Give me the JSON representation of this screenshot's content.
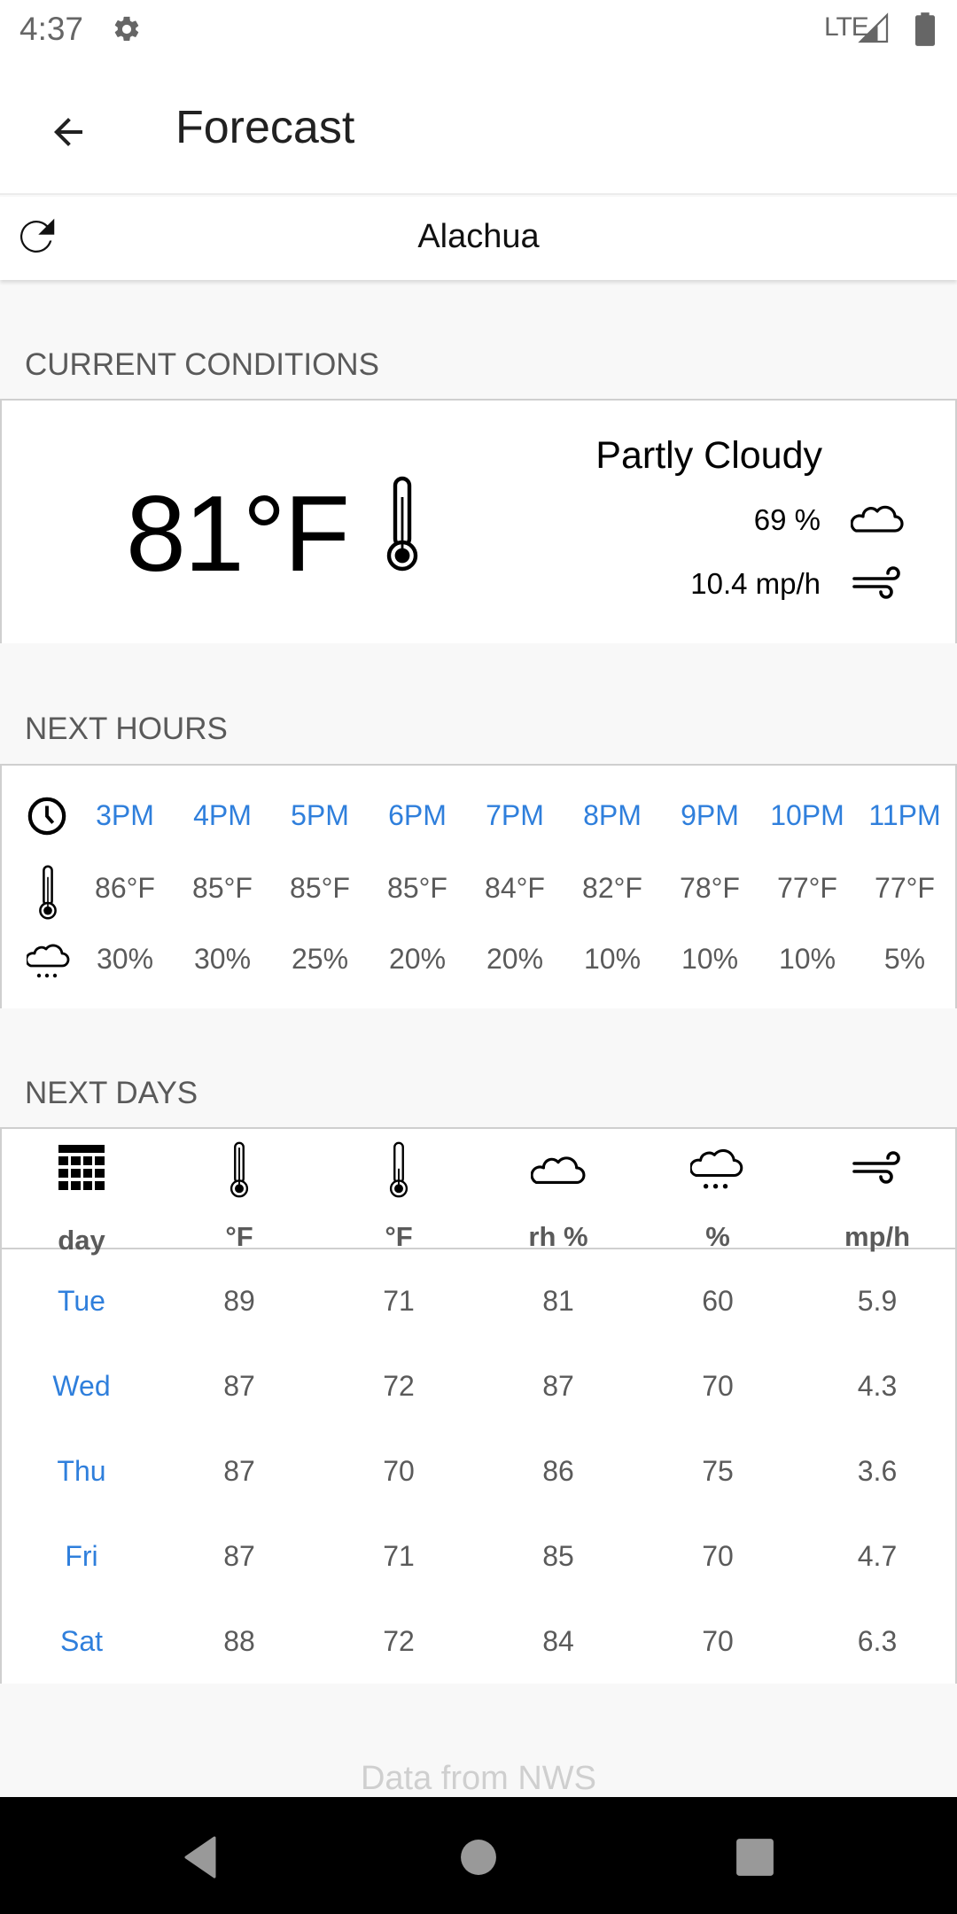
{
  "status_bar": {
    "time": "4:37",
    "network": "LTE",
    "icons": [
      "gear-icon",
      "signal-icon",
      "battery-icon"
    ]
  },
  "app_bar": {
    "title": "Forecast",
    "back_icon": "arrow-left-icon"
  },
  "location_bar": {
    "location": "Alachua",
    "refresh_icon": "refresh-icon"
  },
  "current_conditions": {
    "header": "CURRENT CONDITIONS",
    "temperature": "81°F",
    "condition": "Partly Cloudy",
    "humidity": "69 %",
    "wind": "10.4 mp/h"
  },
  "next_hours": {
    "header": "NEXT HOURS",
    "times": [
      "3PM",
      "4PM",
      "5PM",
      "6PM",
      "7PM",
      "8PM",
      "9PM",
      "10PM",
      "11PM"
    ],
    "temperatures": [
      "86°F",
      "85°F",
      "85°F",
      "85°F",
      "84°F",
      "82°F",
      "78°F",
      "77°F",
      "77°F"
    ],
    "precipitation": [
      "30%",
      "30%",
      "25%",
      "20%",
      "20%",
      "10%",
      "10%",
      "10%",
      "5%"
    ]
  },
  "next_days": {
    "header": "NEXT DAYS",
    "columns": [
      {
        "icon": "calendar-icon",
        "label": "day"
      },
      {
        "icon": "thermometer-high-icon",
        "label": "°F"
      },
      {
        "icon": "thermometer-low-icon",
        "label": "°F"
      },
      {
        "icon": "cloud-icon",
        "label": "rh %"
      },
      {
        "icon": "rain-cloud-icon",
        "label": "%"
      },
      {
        "icon": "wind-icon",
        "label": "mp/h"
      }
    ],
    "rows": [
      [
        "Tue",
        "89",
        "71",
        "81",
        "60",
        "5.9"
      ],
      [
        "Wed",
        "87",
        "72",
        "87",
        "70",
        "4.3"
      ],
      [
        "Thu",
        "87",
        "70",
        "86",
        "75",
        "3.6"
      ],
      [
        "Fri",
        "87",
        "71",
        "85",
        "70",
        "4.7"
      ],
      [
        "Sat",
        "88",
        "72",
        "84",
        "70",
        "6.3"
      ]
    ]
  },
  "footer": {
    "note": "Data from NWS"
  },
  "nav_bar": {
    "buttons": [
      "back",
      "home",
      "recents"
    ]
  },
  "colors": {
    "accent": "#2f7fdc",
    "secondary_text": "#5a5a5a",
    "background": "#f8f8f8"
  }
}
